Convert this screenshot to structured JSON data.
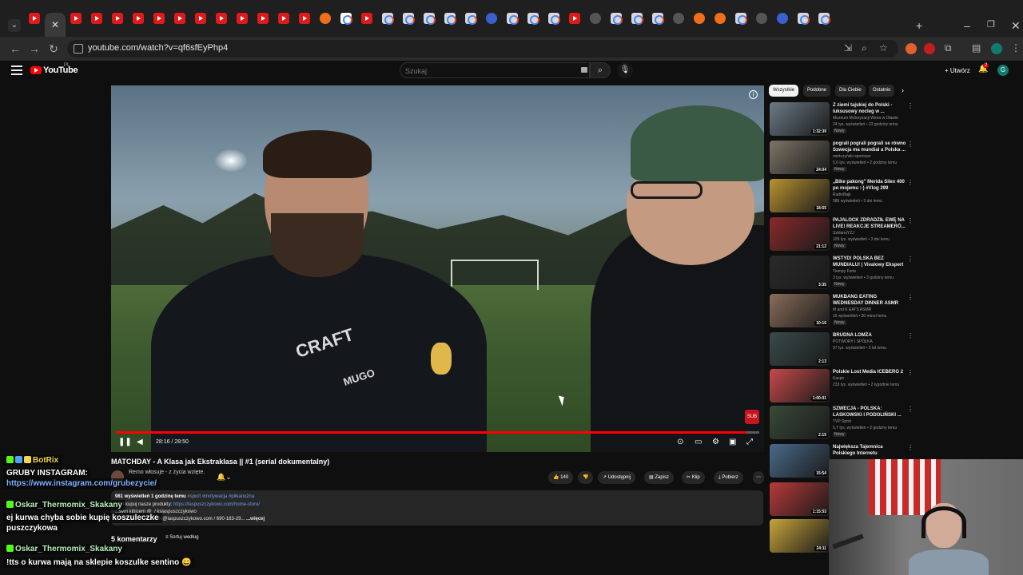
{
  "browser": {
    "url": "youtube.com/watch?v=qf6sfEyPhp4",
    "colors": {
      "tab_strip": "#1f1f1f",
      "toolbar": "#2b2b2b"
    }
  },
  "masthead": {
    "logo_text": "YouTube",
    "logo_suffix": "PL",
    "search_placeholder": "Szukaj",
    "create_label": "Utwórz",
    "notification_count": "2",
    "avatar_letter": "G"
  },
  "player": {
    "time_display": "28:16 / 28:50",
    "progress": 0.98,
    "sub_badge": "SUB",
    "jersey_text_1": "CRAFT",
    "jersey_text_2": "MUGO"
  },
  "video": {
    "title": "MATCHDAY - A Klasa jak Ekstraklasa || #1 (serial dokumentalny)",
    "channel": "Remo włosuje - z życia wzięte.",
    "actions": {
      "likes": "140",
      "share": "Udostępnij",
      "save": "Zapisz",
      "clip": "Klip",
      "download": "Pobierz"
    },
    "description": {
      "meta": "981 wyświetleń  1 godzinę temu",
      "tags": "#sport #motywacja #piłkanożna",
      "line2_text": "...b i kupuj nasze produkty:",
      "line2_link": "https://laspuszczykowo.com/home-store/",
      "line3": "...sym kibicem  @_/ kslaspuszczykowo",
      "line4": "...kt: skwarek.sawinski@laspuszczykowo.com / 690-183-29...",
      "more": "...więcej"
    },
    "comments_label": "5 komentarzy",
    "sort_label": "Sortuj według"
  },
  "chat": [
    {
      "name": "BotRix",
      "name_color": "#53fc18",
      "text": ""
    },
    {
      "name": "",
      "text": "GRUBY INSTAGRAM:"
    },
    {
      "name": "",
      "text": "https://www.instagram.com/grubezycie/"
    },
    {
      "name": "Oskar_Thermomix_Skakany",
      "text": ""
    },
    {
      "name": "",
      "text": "ej kurwa chyba sobie kupię koszuleczke"
    },
    {
      "name": "",
      "text": "puszczykowa"
    },
    {
      "name": "Oskar_Thermomix_Skakany",
      "text": ""
    },
    {
      "name": "",
      "text": "!tts o kurwa mają na sklepie koszulke sentino 😄"
    }
  ],
  "sidebar": {
    "chips": [
      "Wszystkie",
      "Podobne",
      "Dla Ciebie",
      "Ostatnio"
    ],
    "videos": [
      {
        "title": "Z ziemi tajskiej do Polski - luksusowy nocleg w ...",
        "channel": "Muzeum Motoryzacji Wena w Oławie",
        "meta": "24 tys. wyświetleń • 23 godziny temu",
        "badge": "Nowy",
        "duration": "1:32:39",
        "thumb_color": "#6c7a86"
      },
      {
        "title": "pograli pograli pograli se równo Szwecja ma mundial a Polska ...",
        "channel": "mietczyński sportowo",
        "meta": "5,6 tys. wyświetleń • 2 godziny temu",
        "badge": "Nowy",
        "duration": "24:04",
        "thumb_color": "#7d7466"
      },
      {
        "title": "„Bike pakong\" Merida Silex 400 po mojemu :-) #Vlog 299",
        "channel": "RadioBajk",
        "meta": "986 wyświetleń • 2 dni temu",
        "badge": "",
        "duration": "18:55",
        "thumb_color": "#b8932e"
      },
      {
        "title": "PAJALOCK ZDRADZIŁ EWĘ NA LIVE! REAKCJE STREAMERÓ...",
        "channel": "SzklanaYZJ",
        "meta": "109 tys. wyświetleń • 3 dni temu",
        "badge": "Nowy",
        "duration": "21:12",
        "thumb_color": "#8a2a2a"
      },
      {
        "title": "WSTYD! POLSKA BEZ MUNDIALU! | Vivalowy Ekspert",
        "channel": "Tiempy Forte",
        "meta": "3 tys. wyświetleń • 3 godziny temu",
        "badge": "Nowy",
        "duration": "3:35",
        "thumb_color": "#2a2a2a"
      },
      {
        "title": "MUKBANG EATING WEDNESDAY DINNER ASMR",
        "channel": "M and K EATS ASMR",
        "meta": "15 wyświetleń • 30 minut temu",
        "badge": "Nowy",
        "duration": "10:16",
        "thumb_color": "#8a6d5a"
      },
      {
        "title": "BRUDNA LOMŻA",
        "channel": "POTWORY I SPÓŁKA",
        "meta": "97 tys. wyświetleń • 5 lat temu",
        "badge": "",
        "duration": "2:13",
        "thumb_color": "#3a4a4a"
      },
      {
        "title": "Polskie Lost Media ICEBERG 2",
        "channel": "Kacpir",
        "meta": "233 tys. wyświetleń • 2 tygodnie temu",
        "badge": "",
        "duration": "1:00:01",
        "thumb_color": "#c84a4a"
      },
      {
        "title": "SZWECJA - POLSKA: LASKOWSKI I PODOLIŃSKI ...",
        "channel": "TVP Sport",
        "meta": "5,7 tys. wyświetleń • 2 godziny temu",
        "badge": "Nowy",
        "duration": "2:15",
        "thumb_color": "#3a4a3a"
      },
      {
        "title": "Największa Tajemnica Polskiego Internetu",
        "channel": "",
        "meta": "",
        "badge": "",
        "duration": "15:54",
        "thumb_color": "#4a6a8a"
      },
      {
        "title": "",
        "channel": "",
        "meta": "",
        "badge": "",
        "duration": "1:15:53",
        "thumb_color": "#b83a3a"
      },
      {
        "title": "",
        "channel": "",
        "meta": "",
        "badge": "",
        "duration": "24:11",
        "thumb_color": "#c8a43a"
      }
    ]
  }
}
